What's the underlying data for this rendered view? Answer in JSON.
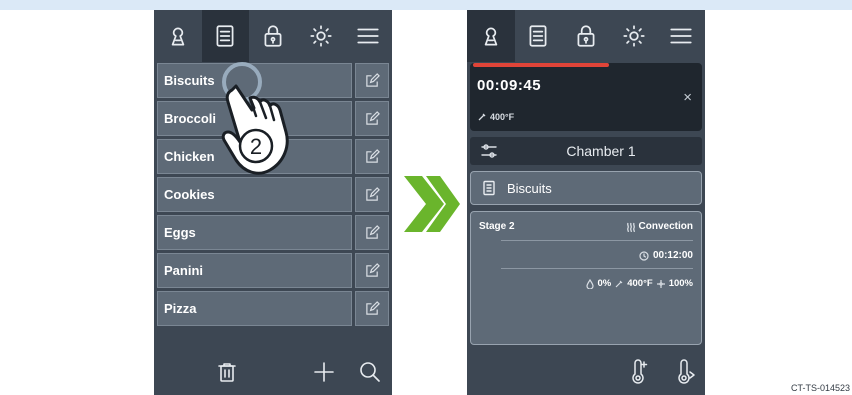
{
  "left_screen": {
    "tabs": [
      {
        "icon": "chef-icon",
        "active": false
      },
      {
        "icon": "recipe-book-icon",
        "active": true
      },
      {
        "icon": "lock-icon",
        "active": false
      },
      {
        "icon": "sun-icon",
        "active": false
      },
      {
        "icon": "menu-icon",
        "active": false
      }
    ],
    "recipes": [
      "Biscuits",
      "Broccoli",
      "Chicken",
      "Cookies",
      "Eggs",
      "Panini",
      "Pizza"
    ],
    "step_marker": "2",
    "bottom_icons": [
      "trash-icon",
      "plus-icon",
      "search-icon"
    ]
  },
  "right_screen": {
    "tabs": [
      {
        "icon": "chef-icon",
        "active": true
      },
      {
        "icon": "recipe-book-icon",
        "active": false
      },
      {
        "icon": "lock-icon",
        "active": false
      },
      {
        "icon": "sun-icon",
        "active": false
      },
      {
        "icon": "menu-icon",
        "active": false
      }
    ],
    "timer": {
      "time": "00:09:45",
      "close_symbol": "×",
      "temperature": "400°F",
      "progress": 0.6
    },
    "chamber_label": "Chamber 1",
    "recipe_name": "Biscuits",
    "stage": {
      "title": "Stage 2",
      "mode": "Convection",
      "duration": "00:12:00",
      "humidity": "0%",
      "temperature": "400°F",
      "fan": "100%"
    },
    "bottom_icons": [
      "probe-add-icon",
      "probe-remove-icon"
    ]
  },
  "colors": {
    "panel": "#3d4753",
    "active_tab": "#2a323c",
    "row": "#5e6a77",
    "progress": "#e04438",
    "chevron": "#6ab52c"
  },
  "figure_id": "CT-TS-014523"
}
